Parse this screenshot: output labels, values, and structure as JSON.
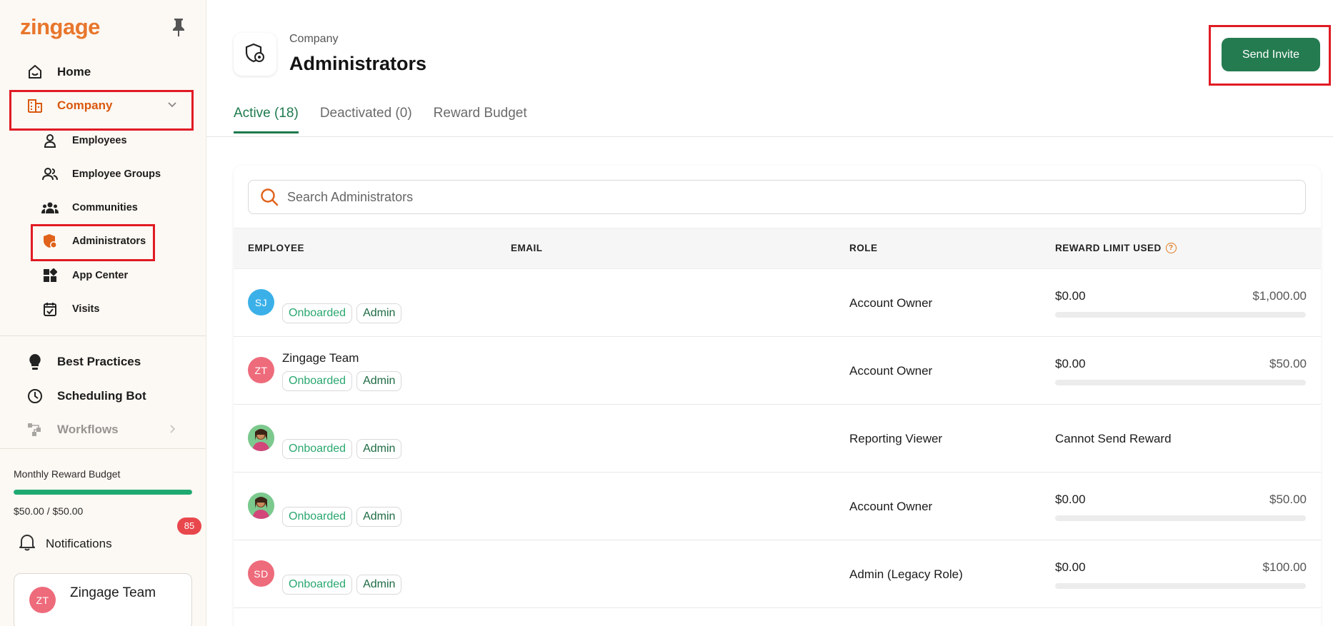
{
  "sidebar": {
    "logo": "zingage",
    "nav": {
      "home": "Home",
      "company": "Company",
      "best_practices": "Best Practices",
      "scheduling_bot": "Scheduling Bot",
      "workflows": "Workflows"
    },
    "sub": {
      "employees": "Employees",
      "employee_groups": "Employee Groups",
      "communities": "Communities",
      "administrators": "Administrators",
      "app_center": "App Center",
      "visits": "Visits"
    },
    "budget": {
      "label": "Monthly Reward Budget",
      "value": "$50.00 / $50.00",
      "progress": 1.0
    },
    "notifications": {
      "label": "Notifications",
      "count": "85"
    },
    "user": {
      "initials": "ZT",
      "name": "Zingage Team"
    }
  },
  "header": {
    "breadcrumb": "Company",
    "title": "Administrators",
    "send_invite": "Send Invite"
  },
  "tabs": [
    {
      "label": "Active (18)",
      "active": true
    },
    {
      "label": "Deactivated (0)",
      "active": false
    },
    {
      "label": "Reward Budget",
      "active": false
    }
  ],
  "search": {
    "placeholder": "Search Administrators"
  },
  "table": {
    "columns": {
      "employee": "EMPLOYEE",
      "email": "EMAIL",
      "role": "ROLE",
      "reward": "REWARD LIMIT USED"
    },
    "rows": [
      {
        "initials": "SJ",
        "avatar_color": "#3bb0e8",
        "name": "",
        "status": "Onboarded",
        "type": "Admin",
        "role": "Account Owner",
        "used": "$0.00",
        "limit": "$1,000.00",
        "cannot": ""
      },
      {
        "initials": "ZT",
        "avatar_color": "#ee6b7b",
        "name": "Zingage Team",
        "status": "Onboarded",
        "type": "Admin",
        "role": "Account Owner",
        "used": "$0.00",
        "limit": "$50.00",
        "cannot": ""
      },
      {
        "initials": "",
        "avatar_color": "image",
        "name": "",
        "status": "Onboarded",
        "type": "Admin",
        "role": "Reporting Viewer",
        "used": "",
        "limit": "",
        "cannot": "Cannot Send Reward"
      },
      {
        "initials": "",
        "avatar_color": "image",
        "name": "",
        "status": "Onboarded",
        "type": "Admin",
        "role": "Account Owner",
        "used": "$0.00",
        "limit": "$50.00",
        "cannot": ""
      },
      {
        "initials": "SD",
        "avatar_color": "#ee6b7b",
        "name": "",
        "status": "Onboarded",
        "type": "Admin",
        "role": "Admin (Legacy Role)",
        "used": "$0.00",
        "limit": "$100.00",
        "cannot": ""
      }
    ]
  },
  "colors": {
    "brand": "#e8762c",
    "primary": "#247b50",
    "highlight": "#e01b24"
  }
}
